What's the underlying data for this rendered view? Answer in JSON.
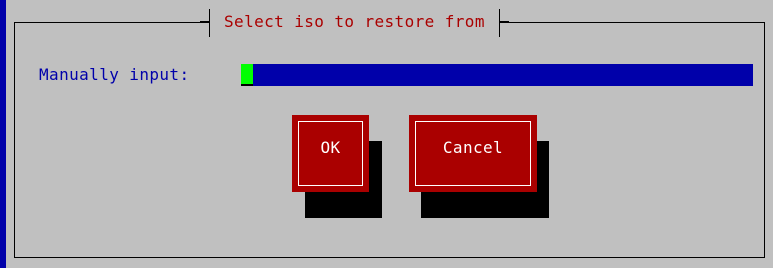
{
  "dialog": {
    "title": "Select iso to restore from",
    "input_label": "Manually input:",
    "input_value": "",
    "ok_label": "OK",
    "cancel_label": "Cancel"
  },
  "colors": {
    "screen_bg": "#0000aa",
    "dialog_bg": "#c0c0c0",
    "title_text": "#aa0000",
    "label_text": "#0000aa",
    "input_bg": "#0000aa",
    "cursor": "#00ff00",
    "button_bg": "#aa0000",
    "button_text": "#ffffff",
    "shadow": "#000000"
  }
}
